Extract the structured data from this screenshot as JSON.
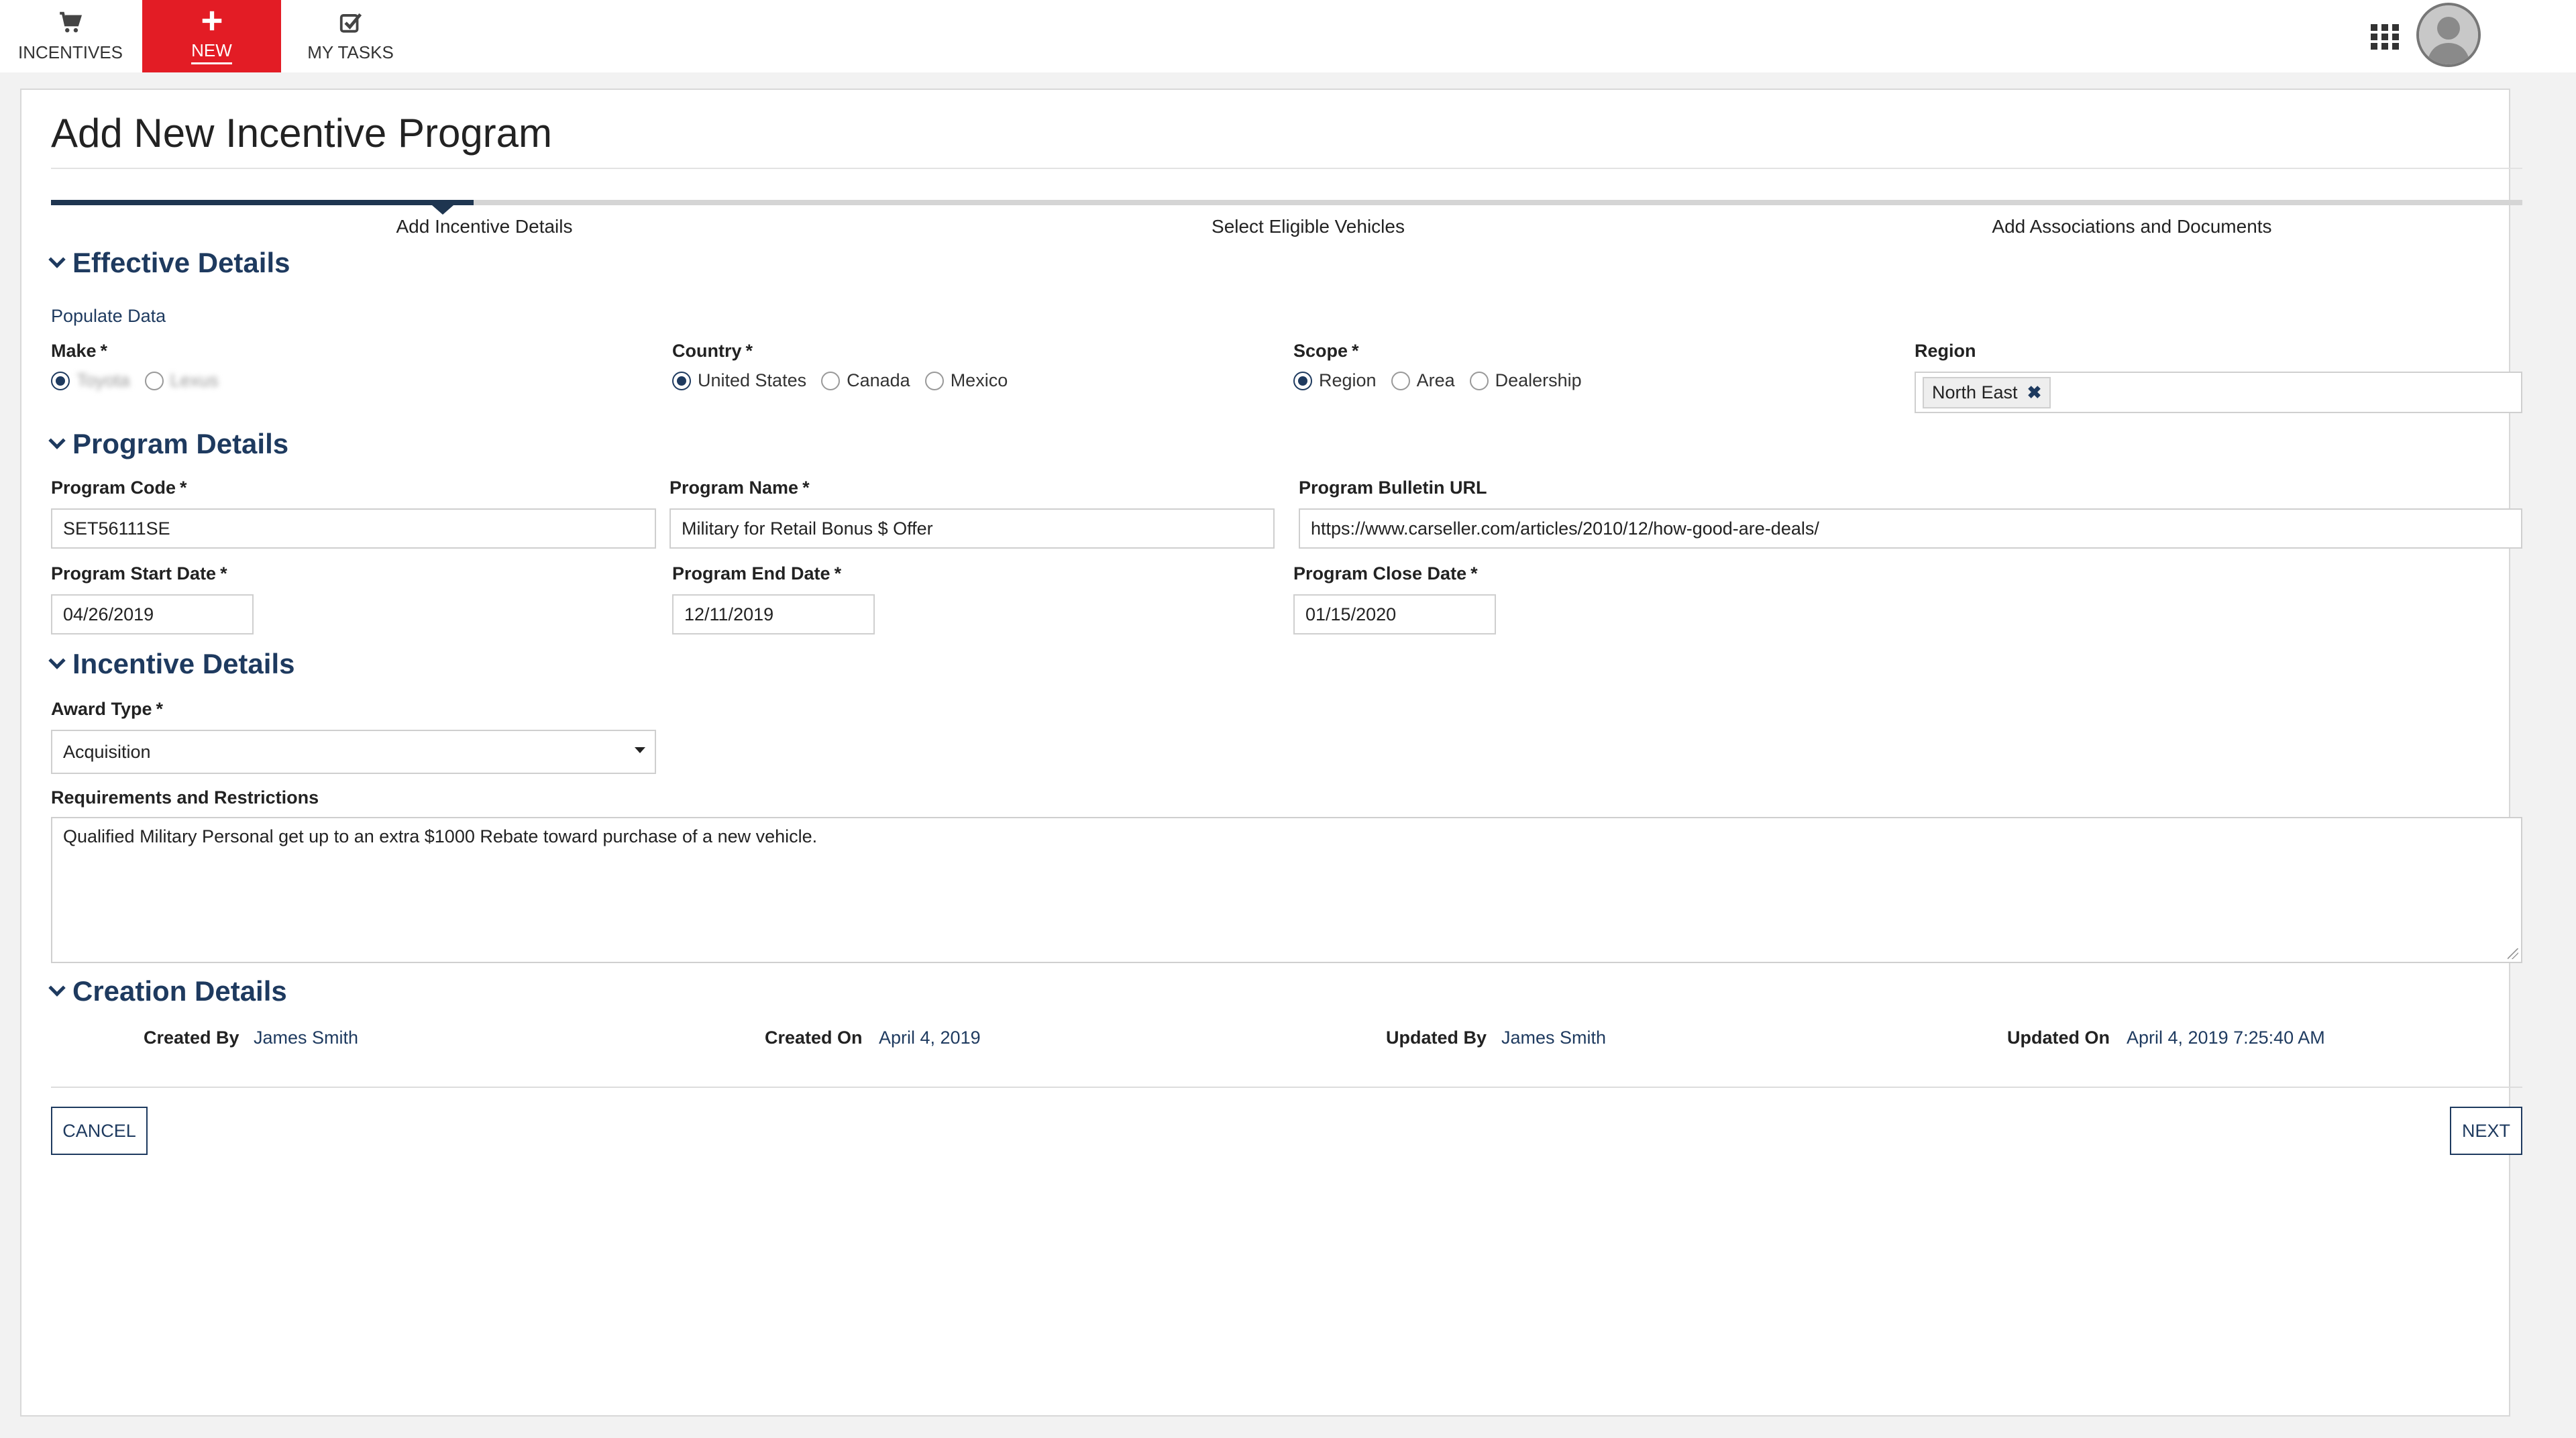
{
  "nav": {
    "incentives_label": "INCENTIVES",
    "new_label": "NEW",
    "tasks_label": "MY TASKS"
  },
  "page": {
    "title": "Add New Incentive Program"
  },
  "steps": [
    "Add Incentive Details",
    "Select Eligible Vehicles",
    "Add Associations and Documents"
  ],
  "effective": {
    "heading": "Effective Details",
    "populate_link": "Populate Data",
    "make_label": "Make",
    "make_options": [
      "Toyota",
      "Lexus"
    ],
    "country_label": "Country",
    "country_options": [
      "United States",
      "Canada",
      "Mexico"
    ],
    "scope_label": "Scope",
    "scope_options": [
      "Region",
      "Area",
      "Dealership"
    ],
    "region_label": "Region",
    "region_chip": "North East",
    "required_mark": "*"
  },
  "program": {
    "heading": "Program Details",
    "code_label": "Program Code",
    "code_value": "SET56111SE",
    "name_label": "Program Name",
    "name_value": "Military for Retail Bonus $ Offer",
    "url_label": "Program Bulletin URL",
    "url_value": "https://www.carseller.com/articles/2010/12/how-good-are-deals/",
    "start_label": "Program Start Date",
    "start_value": "04/26/2019",
    "end_label": "Program End Date",
    "end_value": "12/11/2019",
    "close_label": "Program Close Date",
    "close_value": "01/15/2020"
  },
  "incentive": {
    "heading": "Incentive Details",
    "award_label": "Award Type",
    "award_value": "Acquisition",
    "req_label": "Requirements and Restrictions",
    "req_value": "Qualified Military Personal get up to an extra $1000 Rebate toward purchase of a new vehicle."
  },
  "creation": {
    "heading": "Creation Details",
    "created_by_label": "Created By",
    "created_by_value": "James Smith",
    "created_on_label": "Created On",
    "created_on_value": "April 4, 2019",
    "updated_by_label": "Updated By",
    "updated_by_value": "James Smith",
    "updated_on_label": "Updated On",
    "updated_on_value": "April 4, 2019 7:25:40 AM"
  },
  "actions": {
    "cancel": "CANCEL",
    "next": "NEXT"
  },
  "colors": {
    "accent": "#e31c25",
    "navy": "#1e3a5f"
  }
}
